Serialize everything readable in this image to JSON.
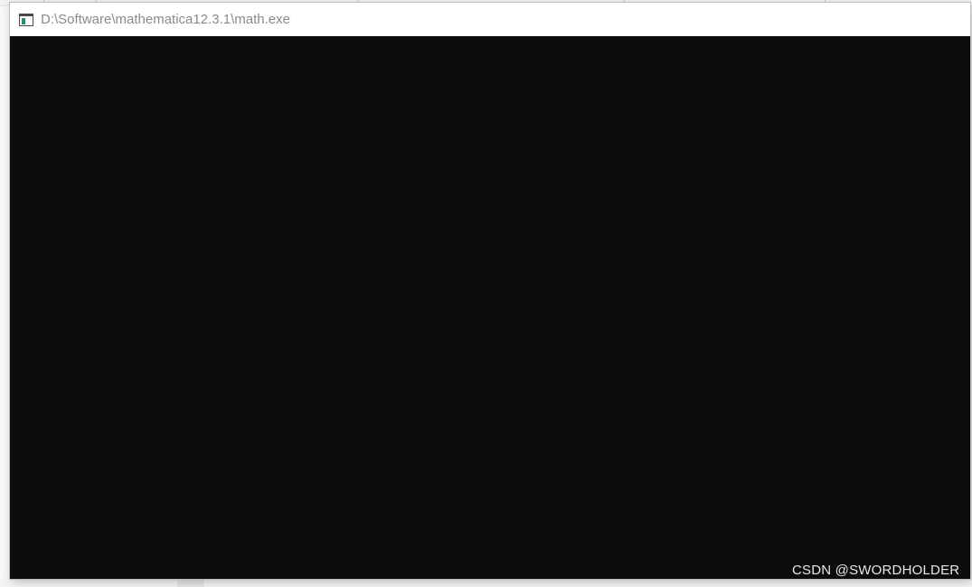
{
  "window": {
    "title": "D:\\Software\\mathematica12.3.1\\math.exe",
    "icon": "console-window-icon",
    "console_text": ""
  },
  "watermark": {
    "text": "CSDN @SWORDHOLDER"
  },
  "colors": {
    "console_background": "#0c0c0c",
    "title_bar_background": "#ffffff",
    "title_text": "#8a8a8a",
    "watermark_text": "#e8e8e8"
  }
}
